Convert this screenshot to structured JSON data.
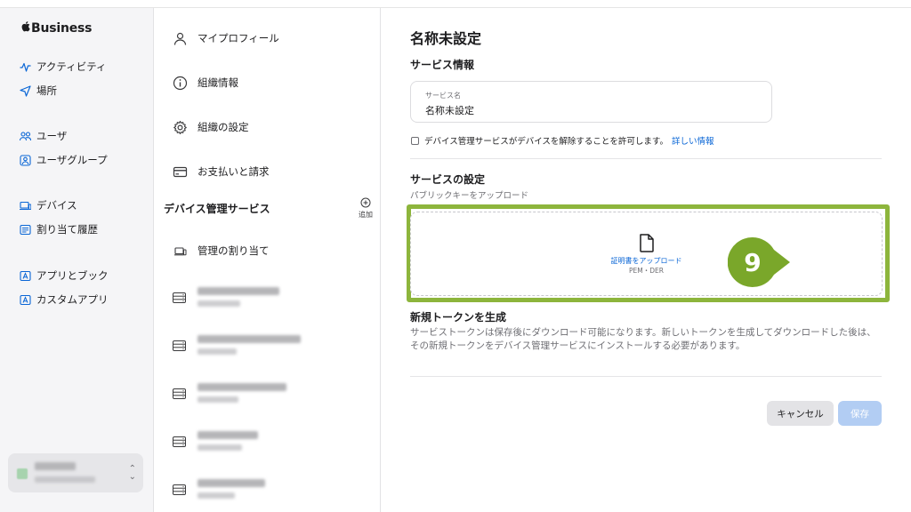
{
  "brand": {
    "name": "Business"
  },
  "sidebar": {
    "items": [
      {
        "label": "アクティビティ",
        "icon": "activity-icon"
      },
      {
        "label": "場所",
        "icon": "location-arrow-icon"
      },
      {
        "label": "ユーザ",
        "icon": "users-icon"
      },
      {
        "label": "ユーザグループ",
        "icon": "user-group-icon"
      },
      {
        "label": "デバイス",
        "icon": "devices-icon"
      },
      {
        "label": "割り当て履歴",
        "icon": "assignment-history-icon"
      },
      {
        "label": "アプリとブック",
        "icon": "apps-books-icon"
      },
      {
        "label": "カスタムアプリ",
        "icon": "custom-apps-icon"
      }
    ]
  },
  "middle": {
    "items": [
      {
        "label": "マイプロフィール",
        "icon": "person-icon"
      },
      {
        "label": "組織情報",
        "icon": "info-icon"
      },
      {
        "label": "組織の設定",
        "icon": "gear-icon"
      },
      {
        "label": "お支払いと請求",
        "icon": "credit-card-icon"
      }
    ],
    "section_header": "デバイス管理サービス",
    "add_label": "追加",
    "assign_label": "管理の割り当て"
  },
  "main": {
    "title": "名称未設定",
    "service_info_title": "サービス情報",
    "service_name_label": "サービス名",
    "service_name_value": "名称未設定",
    "checkbox_label": "デバイス管理サービスがデバイスを解除することを許可します。",
    "learn_more": "詳しい情報",
    "service_settings_title": "サービスの設定",
    "public_key_label": "パブリックキーをアップロード",
    "upload_label": "証明書をアップロード",
    "upload_formats": "PEM・DER",
    "token_title": "新規トークンを生成",
    "token_desc": "サービストークンは保存後にダウンロード可能になります。新しいトークンを生成してダウンロードした後は、その新規トークンをデバイス管理サービスにインストールする必要があります。",
    "cancel_label": "キャンセル",
    "save_label": "保存"
  },
  "annotation": {
    "step": "9"
  },
  "colors": {
    "accent": "#0a66d6",
    "highlight": "#8db53c",
    "badge": "#7aa72a",
    "save_disabled": "#b2cdf3"
  }
}
